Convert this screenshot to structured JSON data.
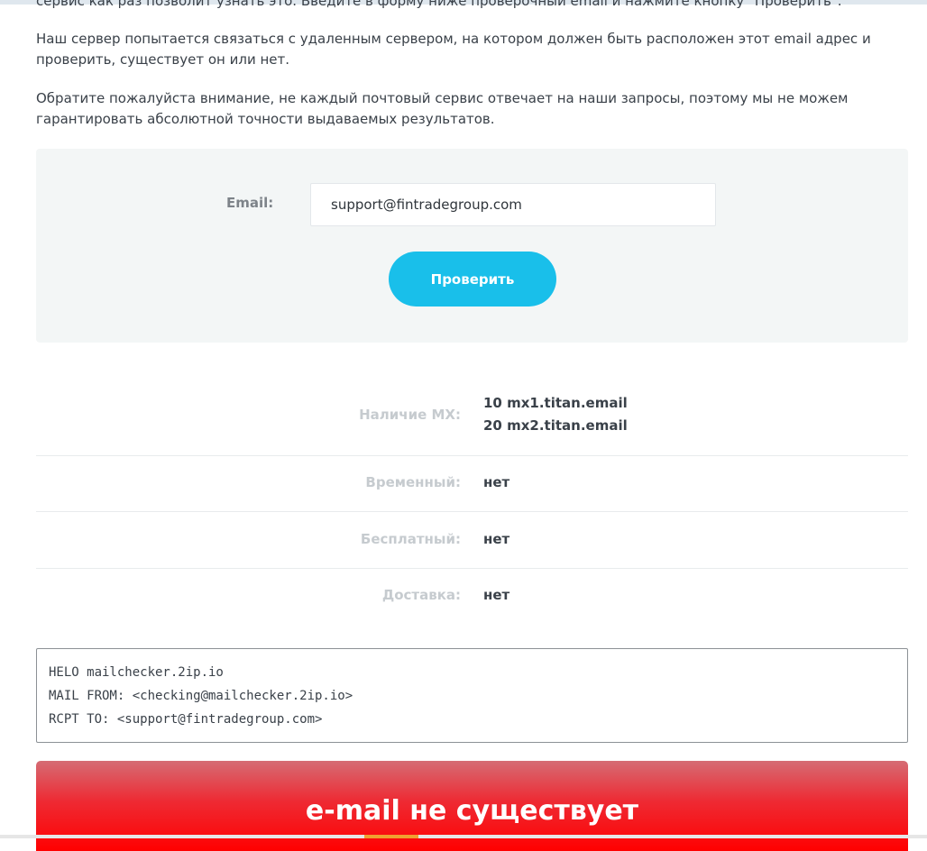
{
  "intro": {
    "cut_line": "сервис как раз позволит узнать это. Введите в форму ниже проверочный email и нажмите кнопку \"Проверить\".",
    "paragraph_1": "Наш сервер попытается связаться с удаленным сервером, на котором должен быть расположен этот email адрес и проверить, существует он или нет.",
    "paragraph_2": "Обратите пожалуйста внимание, не каждый почтовый сервис отвечает на наши запросы, поэтому мы не можем гарантировать абсолютной точности выдаваемых результатов."
  },
  "form": {
    "email_label": "Email:",
    "email_value": "support@fintradegroup.com",
    "check_button": "Проверить"
  },
  "results": {
    "mx": {
      "label": "Наличие MX:",
      "records": [
        {
          "priority": "10",
          "host": "mx1.titan.email"
        },
        {
          "priority": "20",
          "host": "mx2.titan.email"
        }
      ]
    },
    "temporary": {
      "label": "Временный:",
      "value": "нет"
    },
    "free": {
      "label": "Бесплатный:",
      "value": "нет"
    },
    "delivery": {
      "label": "Доставка:",
      "value": "нет"
    }
  },
  "smtp_log": [
    "HELO mailchecker.2ip.io",
    "MAIL FROM: <checking@mailchecker.2ip.io>",
    "RCPT TO: <support@fintradegroup.com>"
  ],
  "result": {
    "message": "e-mail не существует"
  },
  "colors": {
    "button": "#19bfea",
    "error_banner": "#ff0000",
    "panel_bg": "#f3f6f6"
  }
}
